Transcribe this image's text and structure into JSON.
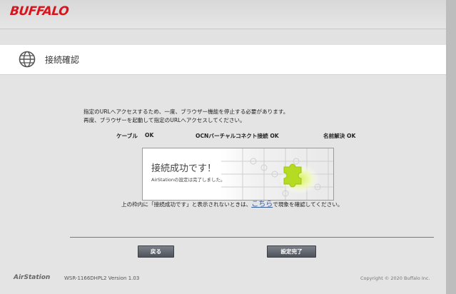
{
  "brand": "BUFFALO",
  "page_title": "接続確認",
  "message": {
    "line1": "指定のURLへアクセスするため、一度、ブラウザー機能を停止する必要があります。",
    "line2": "再度、ブラウザーを起動して指定のURLへアクセスしてください。"
  },
  "status": {
    "cable": "ケーブル",
    "cable_value": "OK",
    "ocn": "OCNバーチャルコネクト接続 OK",
    "dns": "名前解決 OK"
  },
  "result": {
    "title": "接続成功です！",
    "subtitle": "AirStationの設定は完了しました。"
  },
  "hint": {
    "before": "上の枠内に「接続成功です」と表示されないときは、",
    "link": "こちら",
    "after": "で現象を確認してください。"
  },
  "buttons": {
    "back": "戻る",
    "finish": "設定完了"
  },
  "footer": {
    "product": "AirStation",
    "model": "WSR-1166DHPL2 Version 1.03",
    "copyright": "Copyright © 2020 Buffalo Inc."
  },
  "colors": {
    "brand": "#d9141c",
    "link": "#3a5c9a",
    "button": "#5a5e66"
  }
}
